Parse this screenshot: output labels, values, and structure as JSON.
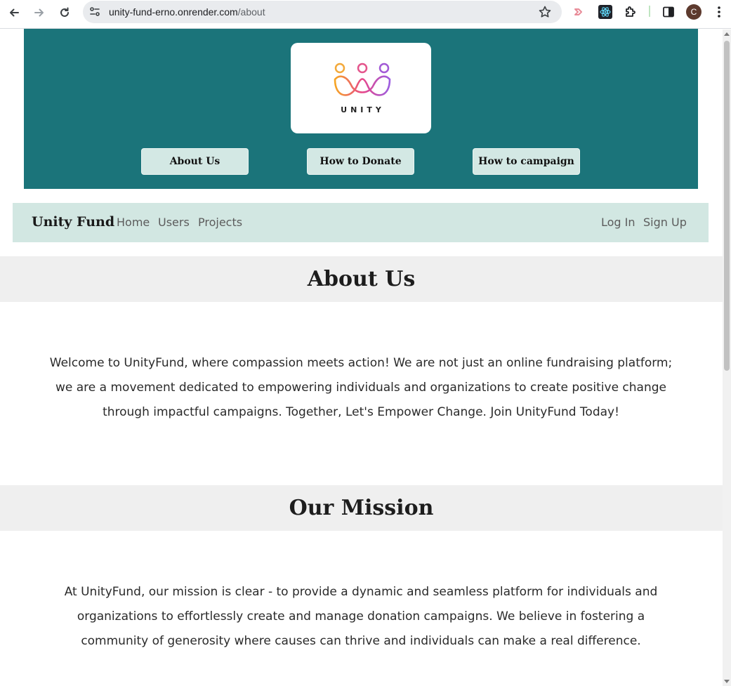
{
  "browser": {
    "url_host": "unity-fund-erno.onrender.com",
    "url_path": "/about",
    "profile_initial": "C"
  },
  "hero": {
    "logo_text": "UNITY",
    "buttons": [
      "About Us",
      "How to Donate",
      "How to campaign"
    ]
  },
  "navbar": {
    "brand": "Unity Fund",
    "links": [
      "Home",
      "Users",
      "Projects"
    ],
    "auth": [
      "Log In",
      "Sign Up"
    ]
  },
  "about": {
    "title": "About Us",
    "text": "Welcome to UnityFund, where compassion meets action! We are not just an online fundraising platform; we are a movement dedicated to empowering individuals and organizations to create positive change through impactful campaigns. Together, Let's Empower Change. Join UnityFund Today!"
  },
  "mission": {
    "title": "Our Mission",
    "text": "At UnityFund, our mission is clear - to provide a dynamic and seamless platform for individuals and organizations to effortlessly create and manage donation campaigns. We believe in fostering a community of generosity where causes can thrive and individuals can make a real difference."
  },
  "colors": {
    "hero_bg": "#1b747a",
    "navbar_bg": "#d2e7e2",
    "button_bg": "#d3e8e4",
    "section_bg": "#efefef"
  },
  "icons": [
    "back-arrow-icon",
    "forward-arrow-icon",
    "reload-icon",
    "site-info-icon",
    "bookmark-star-icon",
    "extension-icons",
    "side-panel-icon",
    "menu-dots-icon",
    "unity-logo"
  ]
}
